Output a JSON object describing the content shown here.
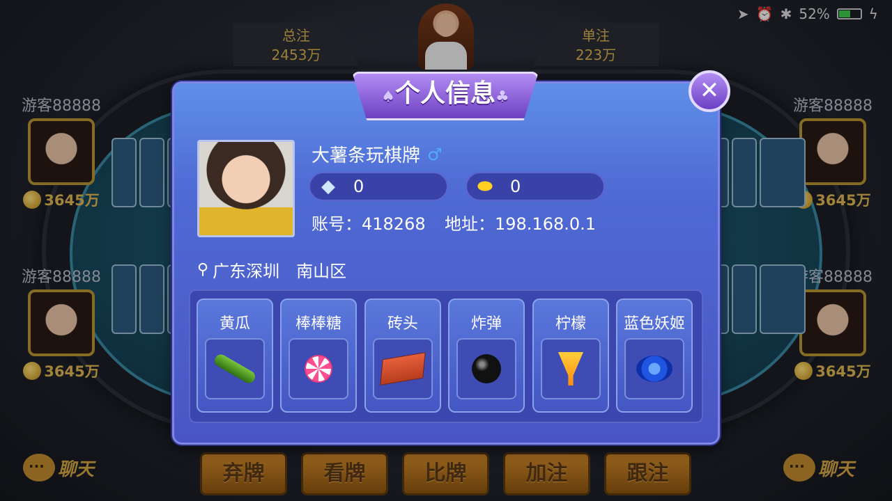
{
  "status_bar": {
    "battery": "52%"
  },
  "table": {
    "total_bet_label": "总注",
    "total_bet_value": "2453万",
    "single_bet_label": "单注",
    "single_bet_value": "223万"
  },
  "players": [
    {
      "name": "游客88888",
      "coins": "3645万"
    },
    {
      "name": "游客88888",
      "coins": "3645万"
    },
    {
      "name": "游客88888",
      "coins": "3645万"
    },
    {
      "name": "游客88888",
      "coins": "3645万"
    }
  ],
  "chat_label": "聊天",
  "actions": [
    "弃牌",
    "看牌",
    "比牌",
    "加注",
    "跟注"
  ],
  "modal": {
    "title": "个人信息",
    "close": "✕",
    "nickname": "大薯条玩棋牌",
    "gender_symbol": "♂",
    "diamonds": "0",
    "gold": "0",
    "account_label": "账号：418268",
    "address_label": "地址：198.168.0.1",
    "location": "广东深圳　南山区",
    "gifts": [
      {
        "name": "黄瓜",
        "icon": "cucumber-icon"
      },
      {
        "name": "棒棒糖",
        "icon": "lollipop-icon"
      },
      {
        "name": "砖头",
        "icon": "brick-icon"
      },
      {
        "name": "炸弹",
        "icon": "bomb-icon"
      },
      {
        "name": "柠檬",
        "icon": "lemon-drink-icon"
      },
      {
        "name": "蓝色妖姬",
        "icon": "blue-rose-icon"
      }
    ]
  }
}
